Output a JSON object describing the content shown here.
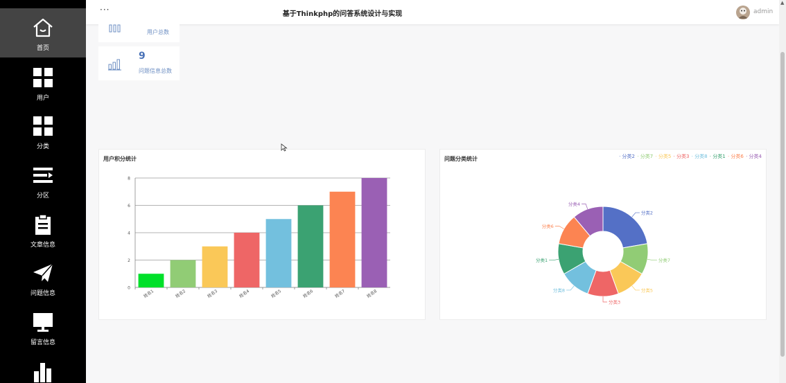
{
  "header": {
    "menu_dots": "···",
    "title": "基于Thinkphp的问答系统设计与实现",
    "user": "admin"
  },
  "sidebar": {
    "items": [
      {
        "label": "首页",
        "icon": "home-icon",
        "active": true
      },
      {
        "label": "用户",
        "icon": "grid-icon"
      },
      {
        "label": "分类",
        "icon": "grid-icon"
      },
      {
        "label": "分区",
        "icon": "list-icon"
      },
      {
        "label": "文章信息",
        "icon": "clipboard-icon"
      },
      {
        "label": "问题信息",
        "icon": "send-icon"
      },
      {
        "label": "留言信息",
        "icon": "monitor-icon"
      },
      {
        "label": "",
        "icon": "bar-chart-icon"
      }
    ]
  },
  "stats": [
    {
      "value": "",
      "label": "用户总数"
    },
    {
      "value": "9",
      "label": "问题信息总数"
    }
  ],
  "panels": {
    "user_points_title": "用户积分统计",
    "question_category_title": "问题分类统计"
  },
  "chart_data": [
    {
      "type": "bar",
      "title": "用户积分统计",
      "categories": [
        "姓名1",
        "姓名2",
        "姓名3",
        "姓名4",
        "姓名5",
        "姓名6",
        "姓名7",
        "姓名8"
      ],
      "values": [
        1,
        2,
        3,
        4,
        5,
        6,
        7,
        8
      ],
      "colors": [
        "#00e02a",
        "#91cc75",
        "#fac858",
        "#ee6666",
        "#73c0de",
        "#3ba272",
        "#fc8452",
        "#9a60b4"
      ],
      "ylim": [
        0,
        8
      ],
      "yticks": [
        0,
        2,
        4,
        6,
        8
      ],
      "grid": true
    },
    {
      "type": "pie",
      "donut": true,
      "title": "问题分类统计",
      "legend_position": "top-right",
      "slices": [
        {
          "name": "分类2",
          "value": 2,
          "color": "#5470c6"
        },
        {
          "name": "分类7",
          "value": 1,
          "color": "#91cc75"
        },
        {
          "name": "分类5",
          "value": 1,
          "color": "#fac858"
        },
        {
          "name": "分类3",
          "value": 1,
          "color": "#ee6666"
        },
        {
          "name": "分类8",
          "value": 1,
          "color": "#73c0de"
        },
        {
          "name": "分类1",
          "value": 1,
          "color": "#3ba272"
        },
        {
          "name": "分类6",
          "value": 1,
          "color": "#fc8452"
        },
        {
          "name": "分类4",
          "value": 1,
          "color": "#9a60b4"
        }
      ]
    }
  ]
}
